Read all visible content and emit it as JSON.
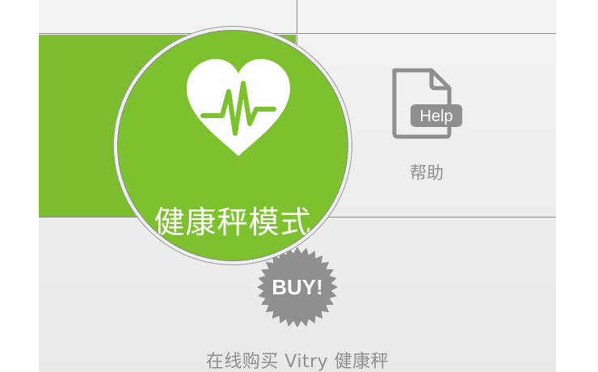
{
  "tiles": {
    "health_mode": {
      "label": "健康秤模式",
      "color": "#7bbd2e",
      "icon": "heart-pulse-icon"
    },
    "help": {
      "label": "帮助",
      "icon_text": "Help",
      "icon": "help-document-icon"
    },
    "buy": {
      "label": "在线购买 Vitry 健康秤",
      "badge_text": "BUY!",
      "icon": "buy-badge-icon"
    }
  }
}
